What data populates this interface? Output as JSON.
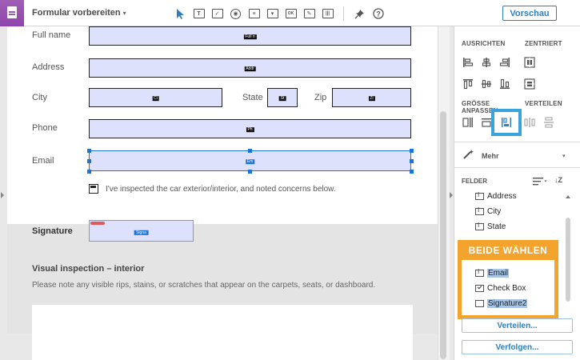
{
  "toolbar": {
    "title": "Formular vorbereiten",
    "title_caret": "▾",
    "tools": [
      {
        "name": "select-tool-icon",
        "glyph": ""
      },
      {
        "name": "text-field-tool-icon",
        "glyph": "T"
      },
      {
        "name": "checkbox-tool-icon",
        "glyph": "✓"
      },
      {
        "name": "radio-tool-icon",
        "glyph": "◉"
      },
      {
        "name": "list-box-tool-icon",
        "glyph": "≡"
      },
      {
        "name": "dropdown-tool-icon",
        "glyph": "▾"
      },
      {
        "name": "button-tool-icon",
        "glyph": "OK"
      },
      {
        "name": "signature-tool-icon",
        "glyph": "✎"
      },
      {
        "name": "barcode-tool-icon",
        "glyph": "|||"
      }
    ],
    "preview_label": "Vorschau"
  },
  "form": {
    "full_name_label": "Full name",
    "full_name_tag": "Full n",
    "address_label": "Address",
    "address_tag": "Addr",
    "city_label": "City",
    "city_tag": "Ci",
    "state_label": "State",
    "state_tag": "St",
    "zip_label": "Zip",
    "zip_tag": "Zi",
    "phone_label": "Phone",
    "phone_tag": "Ph",
    "email_label": "Email",
    "email_tag": "Em",
    "checkbox_tag": "Ch",
    "checkbox_text": "I've inspected the car exterior/interior, and noted concerns below.",
    "signature_label": "Signature",
    "signature_tag": "Signa",
    "visual_title": "Visual inspection – interior",
    "visual_text": "Please note any visible rips, stains, or scratches that appear on the carpets, seats, or dashboard."
  },
  "panel": {
    "align_label": "AUSRICHTEN",
    "center_label": "ZENTRIERT",
    "size_label_1": "GRÖSSE",
    "size_label_2": "ANPASSEN",
    "distribute_label": "VERTEILEN",
    "more_label": "Mehr",
    "more_caret": "▾",
    "fields_label": "FELDER",
    "sort_glyph": "↓Z",
    "fields": [
      {
        "label": "Address",
        "icon": "field"
      },
      {
        "label": "City",
        "icon": "field"
      },
      {
        "label": "State",
        "icon": "field"
      },
      {
        "label": "Email",
        "icon": "field",
        "highlighted": true
      },
      {
        "label": "Check Box",
        "icon": "check"
      },
      {
        "label": "Signature2",
        "icon": "sig",
        "highlighted": true
      }
    ],
    "callout_title": "BEIDE WÄHLEN",
    "distribute_button": "Verteilen...",
    "track_button": "Verfolgen..."
  },
  "colors": {
    "accent": "#2d7fc1",
    "app_tab": "#9b59b6",
    "callout": "#f4a42c",
    "field_fill": "#dde1fb",
    "selection": "#1e73d8",
    "highlight_box": "#3aa3dd"
  }
}
